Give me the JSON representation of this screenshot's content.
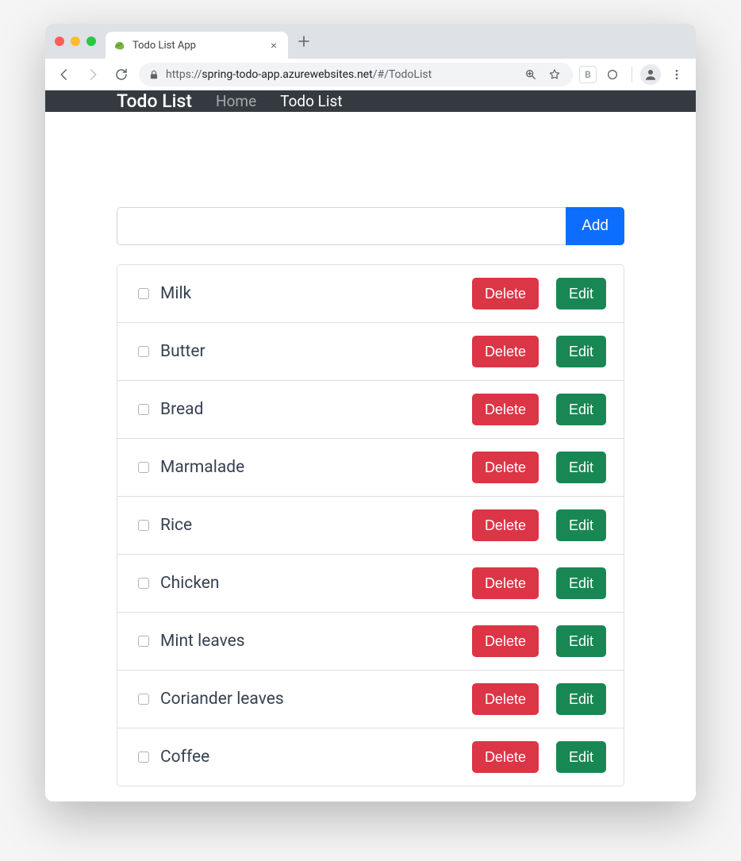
{
  "browser": {
    "tab_title": "Todo List App",
    "url_scheme": "https://",
    "url_host": "spring-todo-app.azurewebsites.net",
    "url_path": "/#/TodoList"
  },
  "navbar": {
    "brand": "Todo List",
    "home_label": "Home",
    "todo_label": "Todo List"
  },
  "addbar": {
    "button_label": "Add"
  },
  "buttons": {
    "delete_label": "Delete",
    "edit_label": "Edit"
  },
  "todos": [
    {
      "text": "Milk"
    },
    {
      "text": "Butter"
    },
    {
      "text": "Bread"
    },
    {
      "text": "Marmalade"
    },
    {
      "text": "Rice"
    },
    {
      "text": "Chicken"
    },
    {
      "text": "Mint leaves"
    },
    {
      "text": "Coriander leaves"
    },
    {
      "text": "Coffee"
    }
  ]
}
